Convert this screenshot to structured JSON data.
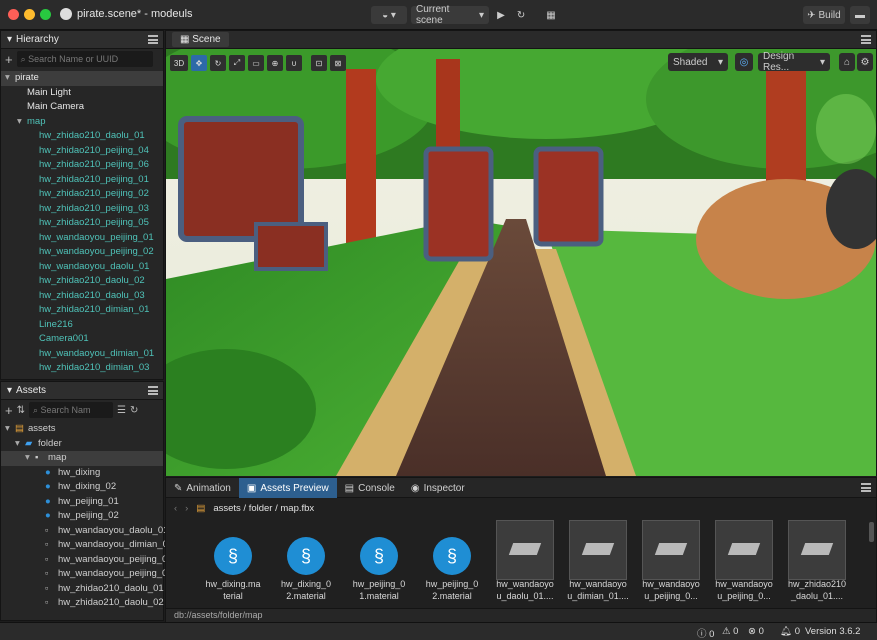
{
  "window": {
    "title": "pirate.scene* - modeuls"
  },
  "toolbar": {
    "scene_select": "Current scene",
    "build": "Build"
  },
  "hierarchy": {
    "title": "Hierarchy",
    "search_placeholder": "Search Name or UUID",
    "items": [
      {
        "label": "pirate",
        "depth": 0,
        "color": "#e6e6e6",
        "arrow": "▾"
      },
      {
        "label": "Main Light",
        "depth": 1,
        "color": "#e6e6e6",
        "arrow": ""
      },
      {
        "label": "Main Camera",
        "depth": 1,
        "color": "#e6e6e6",
        "arrow": ""
      },
      {
        "label": "map",
        "depth": 1,
        "color": "#4fc2b8",
        "arrow": "▾"
      },
      {
        "label": "hw_zhidao210_daolu_01",
        "depth": 2,
        "color": "#4fc2b8",
        "arrow": ""
      },
      {
        "label": "hw_zhidao210_peijing_04",
        "depth": 2,
        "color": "#4fc2b8",
        "arrow": ""
      },
      {
        "label": "hw_zhidao210_peijing_06",
        "depth": 2,
        "color": "#4fc2b8",
        "arrow": ""
      },
      {
        "label": "hw_zhidao210_peijing_01",
        "depth": 2,
        "color": "#4fc2b8",
        "arrow": ""
      },
      {
        "label": "hw_zhidao210_peijing_02",
        "depth": 2,
        "color": "#4fc2b8",
        "arrow": ""
      },
      {
        "label": "hw_zhidao210_peijing_03",
        "depth": 2,
        "color": "#4fc2b8",
        "arrow": ""
      },
      {
        "label": "hw_zhidao210_peijing_05",
        "depth": 2,
        "color": "#4fc2b8",
        "arrow": ""
      },
      {
        "label": "hw_wandaoyou_peijing_01",
        "depth": 2,
        "color": "#4fc2b8",
        "arrow": ""
      },
      {
        "label": "hw_wandaoyou_peijing_02",
        "depth": 2,
        "color": "#4fc2b8",
        "arrow": ""
      },
      {
        "label": "hw_wandaoyou_daolu_01",
        "depth": 2,
        "color": "#4fc2b8",
        "arrow": ""
      },
      {
        "label": "hw_zhidao210_daolu_02",
        "depth": 2,
        "color": "#4fc2b8",
        "arrow": ""
      },
      {
        "label": "hw_zhidao210_daolu_03",
        "depth": 2,
        "color": "#4fc2b8",
        "arrow": ""
      },
      {
        "label": "hw_zhidao210_dimian_01",
        "depth": 2,
        "color": "#4fc2b8",
        "arrow": ""
      },
      {
        "label": "Line216",
        "depth": 2,
        "color": "#4fc2b8",
        "arrow": ""
      },
      {
        "label": "Camera001",
        "depth": 2,
        "color": "#4fc2b8",
        "arrow": ""
      },
      {
        "label": "hw_wandaoyou_dimian_01",
        "depth": 2,
        "color": "#4fc2b8",
        "arrow": ""
      },
      {
        "label": "hw_zhidao210_dimian_03",
        "depth": 2,
        "color": "#4fc2b8",
        "arrow": ""
      }
    ]
  },
  "assets": {
    "title": "Assets",
    "search_placeholder": "Search Nam",
    "items": [
      {
        "label": "assets",
        "depth": 0,
        "icon": "db",
        "arrow": "▾"
      },
      {
        "label": "folder",
        "depth": 1,
        "icon": "folder",
        "arrow": "▾"
      },
      {
        "label": "map",
        "depth": 2,
        "icon": "fbx",
        "arrow": "▾"
      },
      {
        "label": "hw_dixing",
        "depth": 3,
        "icon": "mat",
        "arrow": ""
      },
      {
        "label": "hw_dixing_02",
        "depth": 3,
        "icon": "mat",
        "arrow": ""
      },
      {
        "label": "hw_peijing_01",
        "depth": 3,
        "icon": "mat",
        "arrow": ""
      },
      {
        "label": "hw_peijing_02",
        "depth": 3,
        "icon": "mat",
        "arrow": ""
      },
      {
        "label": "hw_wandaoyou_daolu_01",
        "depth": 3,
        "icon": "mesh",
        "arrow": ""
      },
      {
        "label": "hw_wandaoyou_dimian_01",
        "depth": 3,
        "icon": "mesh",
        "arrow": ""
      },
      {
        "label": "hw_wandaoyou_peijing_01",
        "depth": 3,
        "icon": "mesh",
        "arrow": ""
      },
      {
        "label": "hw_wandaoyou_peijing_02",
        "depth": 3,
        "icon": "mesh",
        "arrow": ""
      },
      {
        "label": "hw_zhidao210_daolu_01",
        "depth": 3,
        "icon": "mesh",
        "arrow": ""
      },
      {
        "label": "hw_zhidao210_daolu_02",
        "depth": 3,
        "icon": "mesh",
        "arrow": ""
      }
    ]
  },
  "scene": {
    "tab": "Scene",
    "mode_3d": "3D",
    "shading": "Shaded",
    "resolution": "Design Res..."
  },
  "bottom": {
    "tabs": [
      "Animation",
      "Assets Preview",
      "Console",
      "Inspector"
    ],
    "active_tab": 1,
    "path": "assets / folder / map.fbx",
    "db_path": "db://assets/folder/map",
    "thumbs": [
      {
        "l1": "hw_dixing.ma",
        "l2": "terial",
        "kind": "mat"
      },
      {
        "l1": "hw_dixing_0",
        "l2": "2.material",
        "kind": "mat"
      },
      {
        "l1": "hw_peijing_0",
        "l2": "1.material",
        "kind": "mat"
      },
      {
        "l1": "hw_peijing_0",
        "l2": "2.material",
        "kind": "mat"
      },
      {
        "l1": "hw_wandaoyo",
        "l2": "u_daolu_01....",
        "kind": "mesh"
      },
      {
        "l1": "hw_wandaoyo",
        "l2": "u_dimian_01....",
        "kind": "mesh"
      },
      {
        "l1": "hw_wandaoyo",
        "l2": "u_peijing_0...",
        "kind": "mesh"
      },
      {
        "l1": "hw_wandaoyo",
        "l2": "u_peijing_0...",
        "kind": "mesh"
      },
      {
        "l1": "hw_zhidao210",
        "l2": "_daolu_01....",
        "kind": "mesh"
      }
    ]
  },
  "status": {
    "c1": "0",
    "c2": "0",
    "c3": "0",
    "c4": "0",
    "version": "Version 3.6.2"
  }
}
